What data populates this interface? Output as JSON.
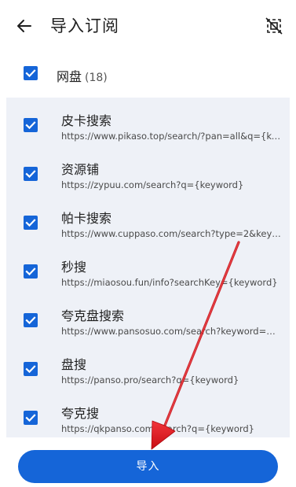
{
  "header": {
    "back_icon": "arrow-left-icon",
    "title": "导入订阅",
    "deselect_icon": "deselect-all-icon"
  },
  "group": {
    "label": "网盘",
    "count": "(18)",
    "checked": true
  },
  "items": [
    {
      "name": "皮卡搜索",
      "url": "https://www.pikaso.top/search/?pan=all&q={ke…",
      "checked": true
    },
    {
      "name": "资源铺",
      "url": "https://zypuu.com/search?q={keyword}",
      "checked": true
    },
    {
      "name": "帕卡搜索",
      "url": "https://www.cuppaso.com/search?type=2&key…",
      "checked": true
    },
    {
      "name": "秒搜",
      "url": "https://miaosou.fun/info?searchKey={keyword}",
      "checked": true
    },
    {
      "name": "夸克盘搜索",
      "url": "https://www.pansosuo.com/search?keyword={k…",
      "checked": true
    },
    {
      "name": "盘搜",
      "url": "https://panso.pro/search?q={keyword}",
      "checked": true
    },
    {
      "name": "夸克搜",
      "url": "https://qkpanso.com/search?q={keyword}",
      "checked": true
    }
  ],
  "import_button": {
    "label": "导入"
  },
  "colors": {
    "accent": "#1565d8",
    "panel_bg": "#eef1f7",
    "annotation": "#e8141b"
  }
}
